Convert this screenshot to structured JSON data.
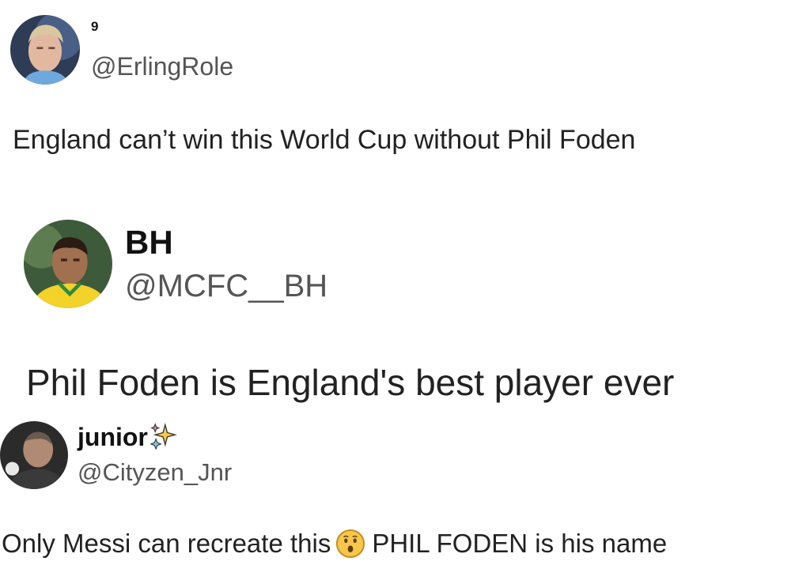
{
  "tweets": [
    {
      "display_name": "9",
      "handle": "@ErlingRole",
      "text": "England can’t win this World Cup without Phil Foden"
    },
    {
      "display_name": "BH",
      "handle": "@MCFC__BH",
      "text": "Phil Foden is England's best player ever"
    },
    {
      "display_name": "junior",
      "name_emoji": "sparkles-icon",
      "handle": "@Cityzen_Jnr",
      "text_before": "Only Messi can recreate this",
      "text_emoji": "hushed-face-icon",
      "text_after": "PHIL FODEN is his name"
    }
  ]
}
